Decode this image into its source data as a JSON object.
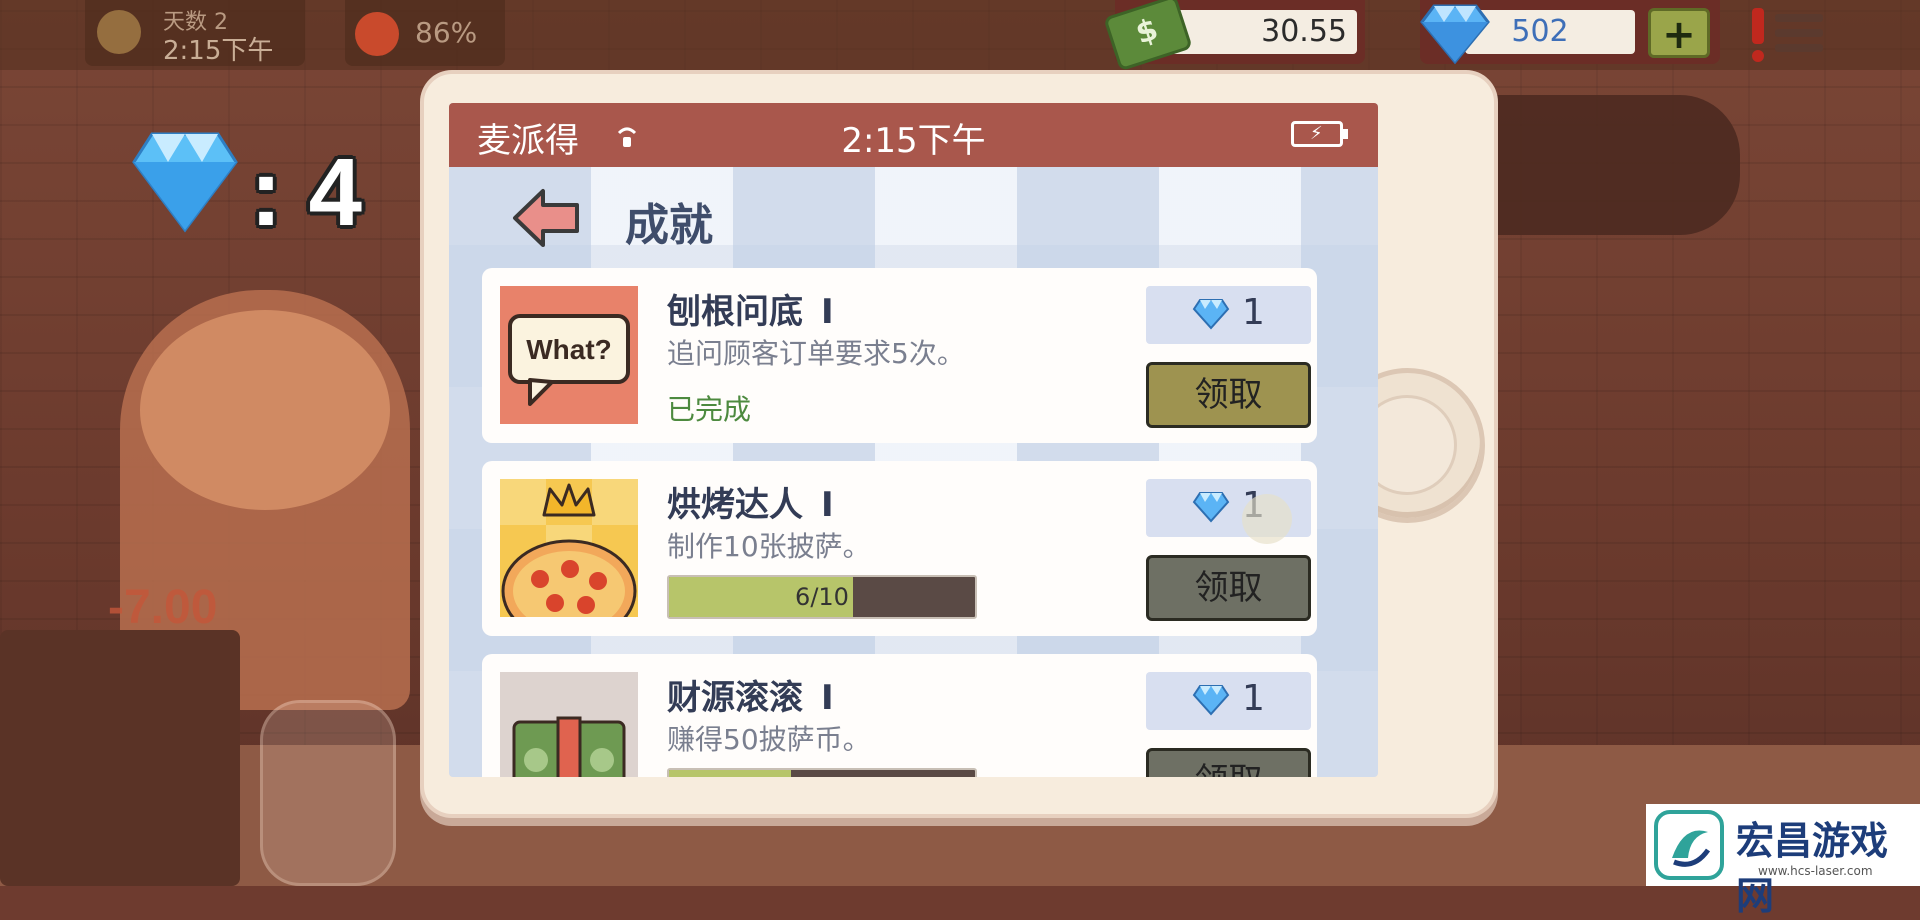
{
  "hud": {
    "day_label": "天数  2",
    "time": "2:15下午",
    "mood_percent": "86%",
    "money": "30.55",
    "gems": "502",
    "add_gems_label": "+"
  },
  "scene": {
    "floating_amount": "-7.00"
  },
  "gem_counter": {
    "separator": ":",
    "value": "4"
  },
  "phone": {
    "status_bar": {
      "carrier": "麦派得",
      "time": "2:15下午"
    },
    "page_title": "成就",
    "achievements": [
      {
        "name": "刨根问底",
        "tier": "I",
        "description": "追问顾客订单要求5次。",
        "status": "已完成",
        "reward": "1",
        "claim_label": "领取",
        "icon_text": "What?"
      },
      {
        "name": "烘烤达人",
        "tier": "I",
        "description": "制作10张披萨。",
        "progress_label": "6/10",
        "progress_fraction": 0.6,
        "reward": "1",
        "claim_label": "领取"
      },
      {
        "name": "财源滚滚",
        "tier": "I",
        "description": "赚得50披萨币。",
        "progress_fraction": 0.4,
        "reward": "1",
        "claim_label": "领取"
      }
    ]
  },
  "watermark": {
    "title": "宏昌游戏网",
    "url": "www.hcs-laser.com"
  },
  "colors": {
    "status_bar": "#a9574c",
    "claim_active": "#9e9350",
    "claim_inactive": "#6e7064",
    "progress_fill": "#b7c56a",
    "gem_blue": "#4aa3f0"
  }
}
